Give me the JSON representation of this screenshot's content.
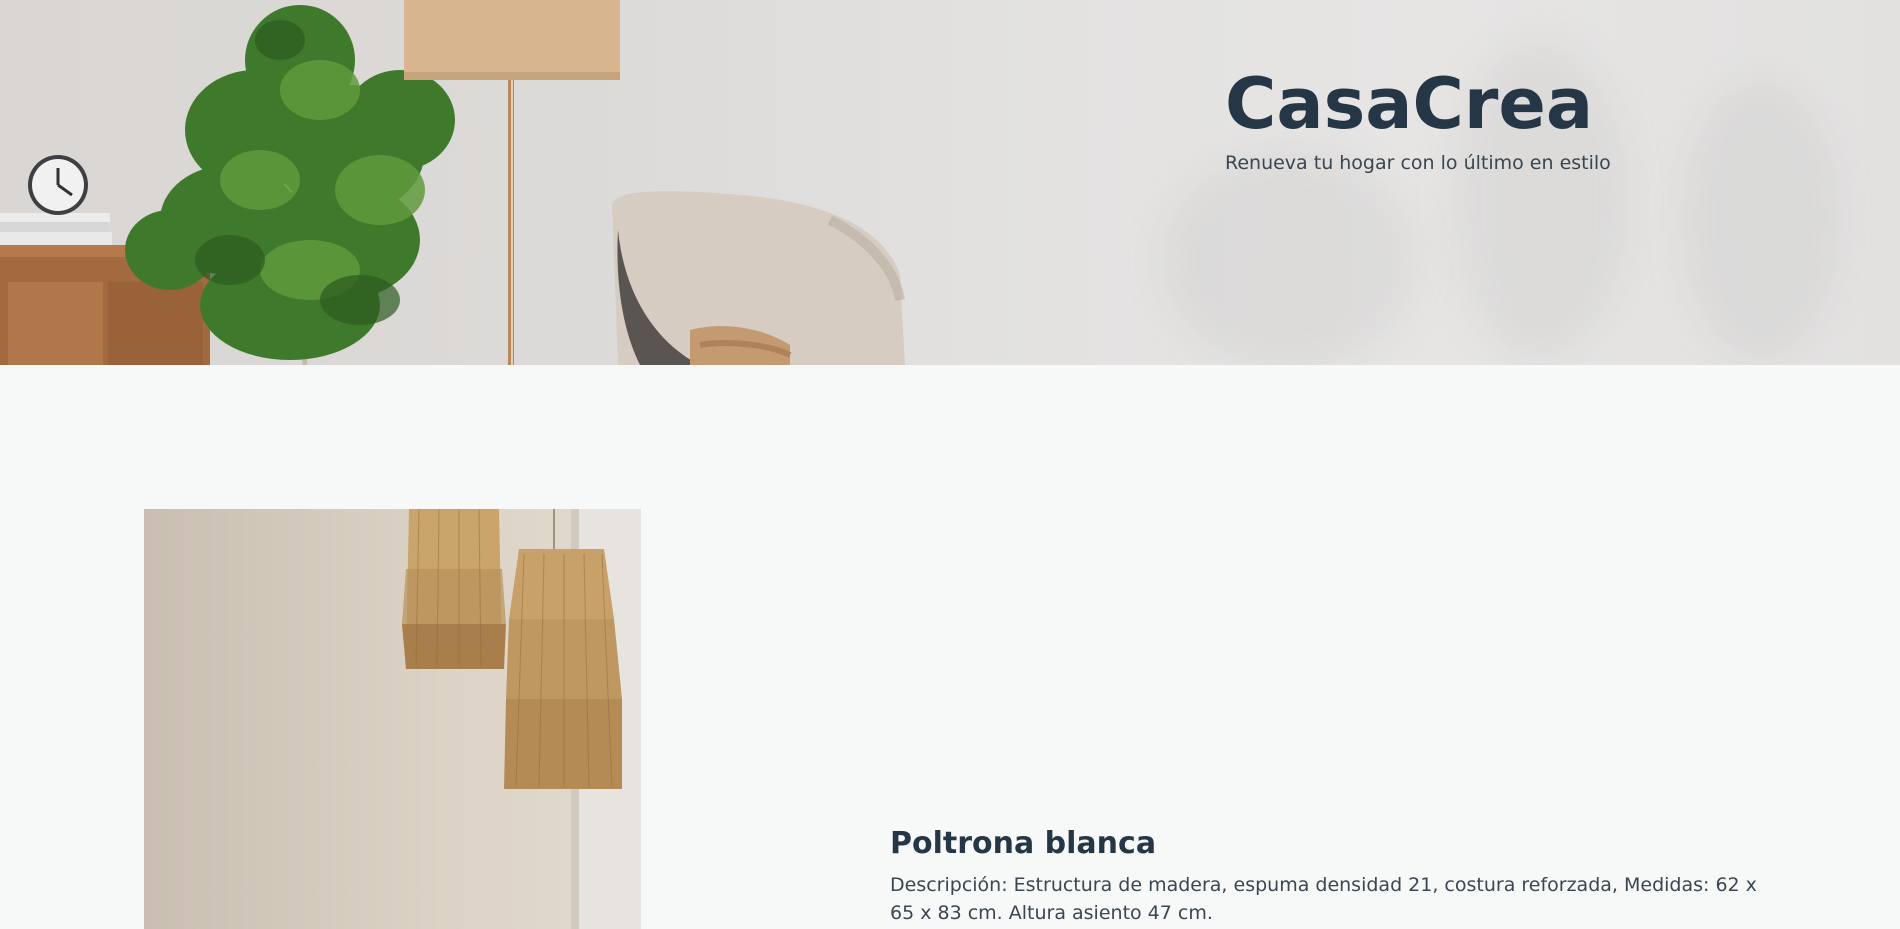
{
  "hero": {
    "brand_title": "CasaCrea",
    "tagline": "Renueva tu hogar con lo último en estilo"
  },
  "product": {
    "name": "Poltrona blanca",
    "description": "Descripción: Estructura de madera, espuma densidad 21, costura reforzada, Medidas: 62 x 65 x 83 cm. Altura asiento 47 cm."
  },
  "colors": {
    "brand_navy": "#253746",
    "text_body": "#3a4651",
    "page_bg": "#f7f9f8"
  }
}
